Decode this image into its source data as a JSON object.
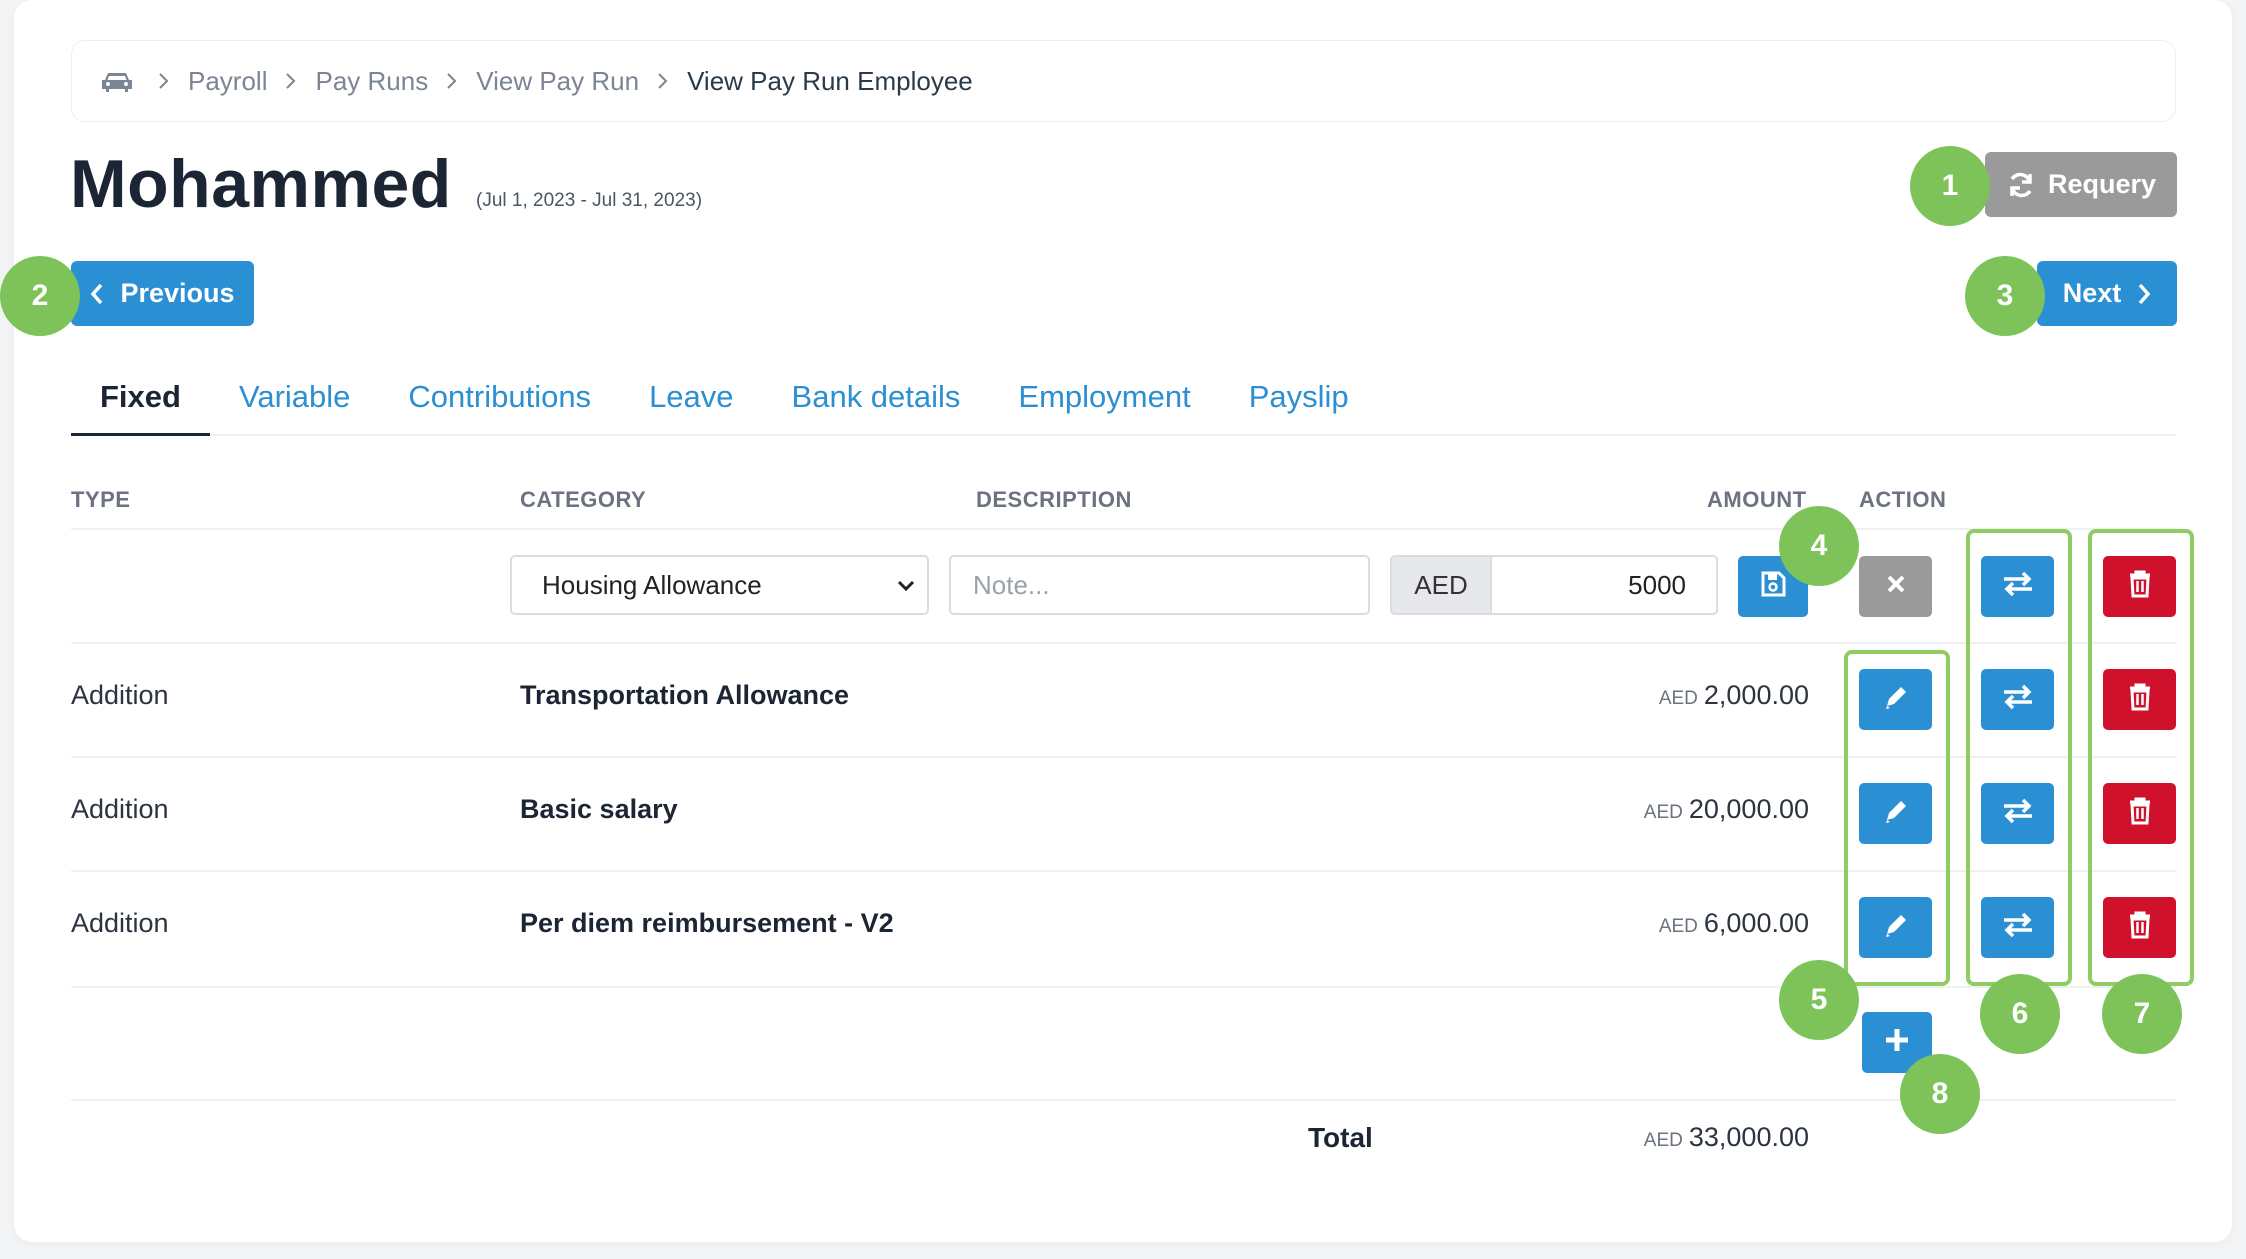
{
  "breadcrumb": {
    "home_icon": "car-icon",
    "items": [
      "Payroll",
      "Pay Runs",
      "View Pay Run",
      "View Pay Run Employee"
    ]
  },
  "header": {
    "title": "Mohammed",
    "date_range": "(Jul 1, 2023 - Jul 31, 2023)",
    "requery_label": "Requery",
    "previous_label": "Previous",
    "next_label": "Next"
  },
  "tabs": [
    "Fixed",
    "Variable",
    "Contributions",
    "Leave",
    "Bank details",
    "Employment",
    "Payslip"
  ],
  "active_tab": "Fixed",
  "table": {
    "headers": {
      "type": "TYPE",
      "category": "CATEGORY",
      "description": "DESCRIPTION",
      "amount": "AMOUNT",
      "action": "ACTION"
    },
    "edit_row": {
      "category_value": "Housing Allowance",
      "description_placeholder": "Note...",
      "currency": "AED",
      "amount_value": "5000"
    },
    "rows": [
      {
        "type": "Addition",
        "category": "Transportation Allowance",
        "currency": "AED",
        "amount": "2,000.00"
      },
      {
        "type": "Addition",
        "category": "Basic salary",
        "currency": "AED",
        "amount": "20,000.00"
      },
      {
        "type": "Addition",
        "category": "Per diem reimbursement - V2",
        "currency": "AED",
        "amount": "6,000.00"
      }
    ],
    "total": {
      "label": "Total",
      "currency": "AED",
      "amount": "33,000.00"
    }
  },
  "annotations": [
    "1",
    "2",
    "3",
    "4",
    "5",
    "6",
    "7",
    "8"
  ],
  "colors": {
    "primary": "#2b90d3",
    "danger": "#d0112b",
    "neutral": "#9a9a9a",
    "annotation": "#7dc35a"
  }
}
